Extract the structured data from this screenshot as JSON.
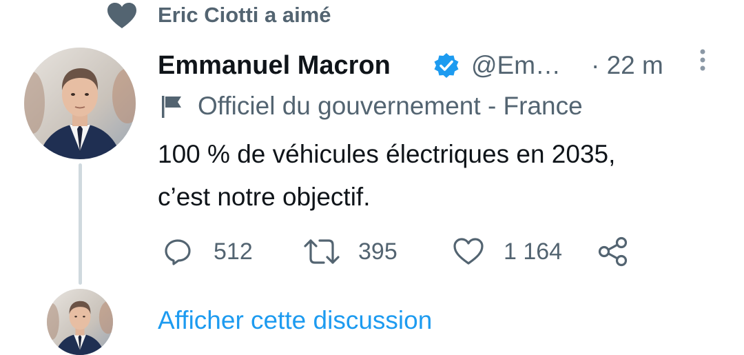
{
  "social_context": {
    "text": "Eric Ciotti a aimé",
    "icon": "heart-icon"
  },
  "tweet": {
    "author_name": "Emmanuel Macron",
    "verified": true,
    "handle": "@Em…",
    "timestamp": "· 22 m",
    "label": "Officiel du gouvernement - France",
    "label_icon": "flag-icon",
    "text": "100 % de véhicules électriques en 2035,\nc’est notre objectif.",
    "actions": {
      "reply_count": "512",
      "retweet_count": "395",
      "like_count": "1 164"
    }
  },
  "thread": {
    "show_thread_label": "Afficher cette discussion"
  },
  "colors": {
    "accent": "#1d9bf0",
    "secondary_text": "#536471",
    "primary_text": "#0f1419",
    "thread_line": "#cfd9de"
  }
}
